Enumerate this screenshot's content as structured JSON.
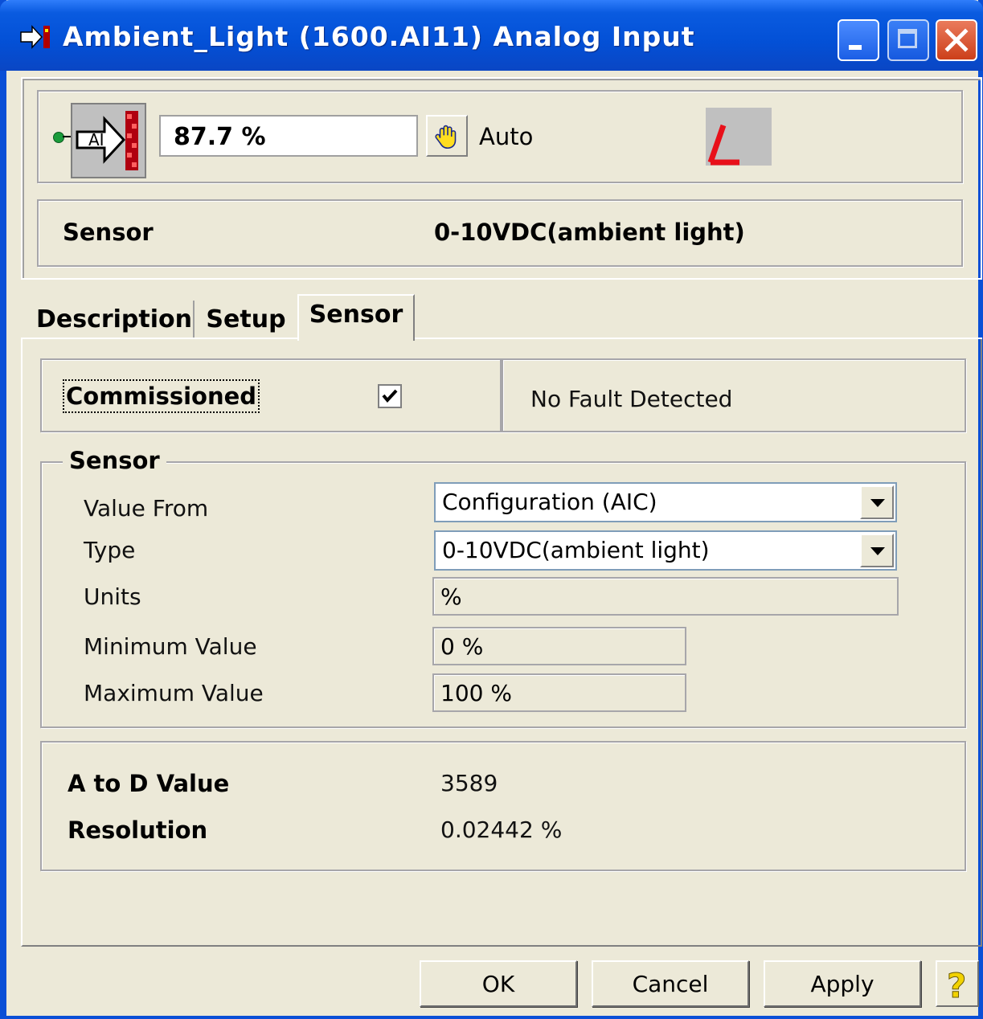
{
  "window": {
    "title": "Ambient_Light  (1600.AI11)  Analog Input"
  },
  "header": {
    "icon_label": "AI",
    "present_value": "87.7 %",
    "mode": "Auto",
    "sensor_label": "Sensor",
    "sensor_value": "0-10VDC(ambient light)"
  },
  "tabs": [
    {
      "label": "Description",
      "active": false
    },
    {
      "label": "Setup",
      "active": false
    },
    {
      "label": "Sensor",
      "active": true
    }
  ],
  "sensor_tab": {
    "commissioned_label": "Commissioned",
    "commissioned_checked": true,
    "fault_status": "No Fault Detected",
    "group_title": "Sensor",
    "fields": {
      "value_from_label": "Value From",
      "value_from": "Configuration (AIC)",
      "type_label": "Type",
      "type": "0-10VDC(ambient light)",
      "units_label": "Units",
      "units": "%",
      "min_label": "Minimum Value",
      "min": "0 %",
      "max_label": "Maximum Value",
      "max": "100 %"
    },
    "a_to_d_label": "A to D Value",
    "a_to_d_value": "3589",
    "resolution_label": "Resolution",
    "resolution_value": "0.02442 %"
  },
  "buttons": {
    "ok": "OK",
    "cancel": "Cancel",
    "apply": "Apply"
  },
  "colors": {
    "titlebar": "#0a5be0",
    "dialog_bg": "#ece9d8",
    "alarm_red": "#e8101a"
  }
}
